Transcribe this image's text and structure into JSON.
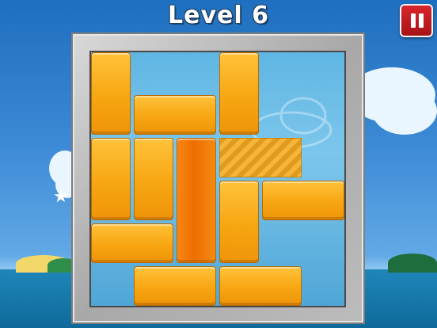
{
  "level": {
    "title": "Level 6",
    "number": 6
  },
  "pause_button": {
    "icon": "pause-icon",
    "color": "#c0161c"
  },
  "colors": {
    "block": "#f7a612",
    "main_block": "#ee6f00",
    "board_water": "#6fbee8",
    "frame": "#b8b8b8"
  },
  "board": {
    "grid_size": 6,
    "blocks": [
      {
        "id": "block-1",
        "col": 0,
        "row": 0,
        "w": 1,
        "h": 2,
        "orientation": "vertical"
      },
      {
        "id": "block-2",
        "col": 3,
        "row": 0,
        "w": 1,
        "h": 2,
        "orientation": "vertical"
      },
      {
        "id": "block-3",
        "col": 1,
        "row": 1,
        "w": 2,
        "h": 1,
        "orientation": "horizontal"
      },
      {
        "id": "block-4",
        "col": 0,
        "row": 2,
        "w": 1,
        "h": 2,
        "orientation": "vertical"
      },
      {
        "id": "block-5",
        "col": 1,
        "row": 2,
        "w": 1,
        "h": 2,
        "orientation": "vertical"
      },
      {
        "id": "main-block",
        "col": 2,
        "row": 2,
        "w": 1,
        "h": 3,
        "orientation": "vertical",
        "main": true
      },
      {
        "id": "block-6",
        "col": 3,
        "row": 3,
        "w": 1,
        "h": 2,
        "orientation": "vertical"
      },
      {
        "id": "block-7",
        "col": 4,
        "row": 3,
        "w": 2,
        "h": 1,
        "orientation": "horizontal"
      },
      {
        "id": "block-8",
        "col": 0,
        "row": 4,
        "w": 2,
        "h": 1,
        "orientation": "horizontal"
      },
      {
        "id": "block-9",
        "col": 1,
        "row": 5,
        "w": 2,
        "h": 1,
        "orientation": "horizontal"
      },
      {
        "id": "block-10",
        "col": 3,
        "row": 5,
        "w": 2,
        "h": 1,
        "orientation": "horizontal"
      }
    ],
    "target": {
      "col": 3,
      "row": 2,
      "w": 2,
      "h": 1
    }
  }
}
